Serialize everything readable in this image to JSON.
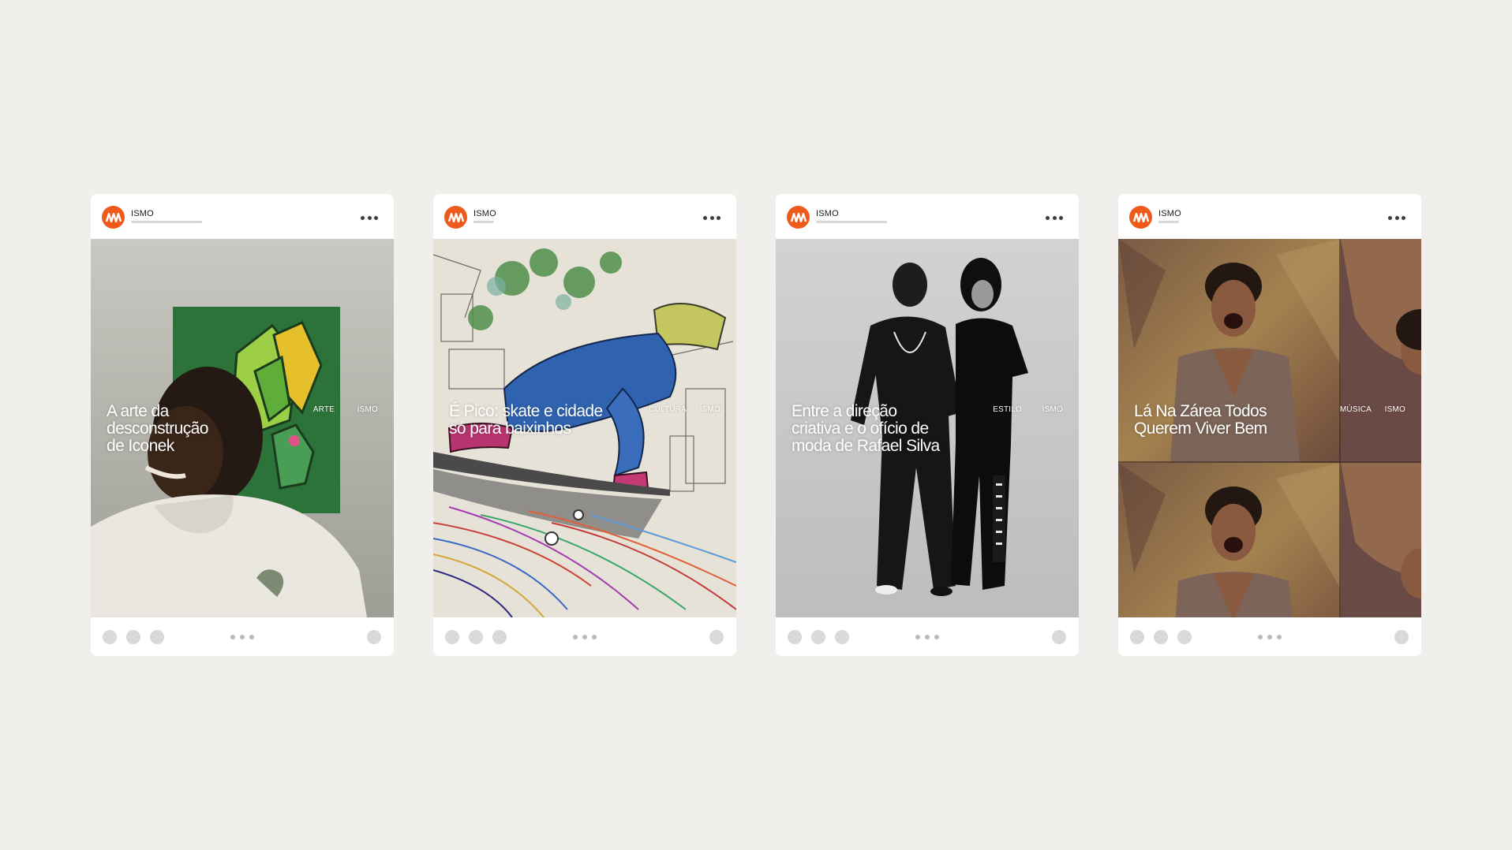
{
  "background_color": "#f0efec",
  "brand_color": "#ee5a1c",
  "posts": [
    {
      "account_name": "ISMO",
      "title": "A arte da\ndesconstrução\nde Iconek",
      "category": "ARTE",
      "brand_tag": "ISMO",
      "image_subject": "man-smiling-in-front-of-green-painting"
    },
    {
      "account_name": "ISMO",
      "title": "É Pico: skate e cidade\nsó para baixinhos",
      "category": "CULTURA",
      "brand_tag": "ISMO",
      "image_subject": "colored-pencil-drawing-of-skater"
    },
    {
      "account_name": "ISMO",
      "title": "Entre a direção\ncriativa e o ofício de\nmoda de Rafael Silva",
      "category": "ESTILO",
      "brand_tag": "ISMO",
      "image_subject": "black-and-white-fashion-portrait-two-people"
    },
    {
      "account_name": "ISMO",
      "title": "Lá Na Zárea Todos\nQuerem Viver Bem",
      "category": "MÚSICA",
      "brand_tag": "ISMO",
      "image_subject": "repeated-collage-portrait-of-man-singing"
    }
  ]
}
